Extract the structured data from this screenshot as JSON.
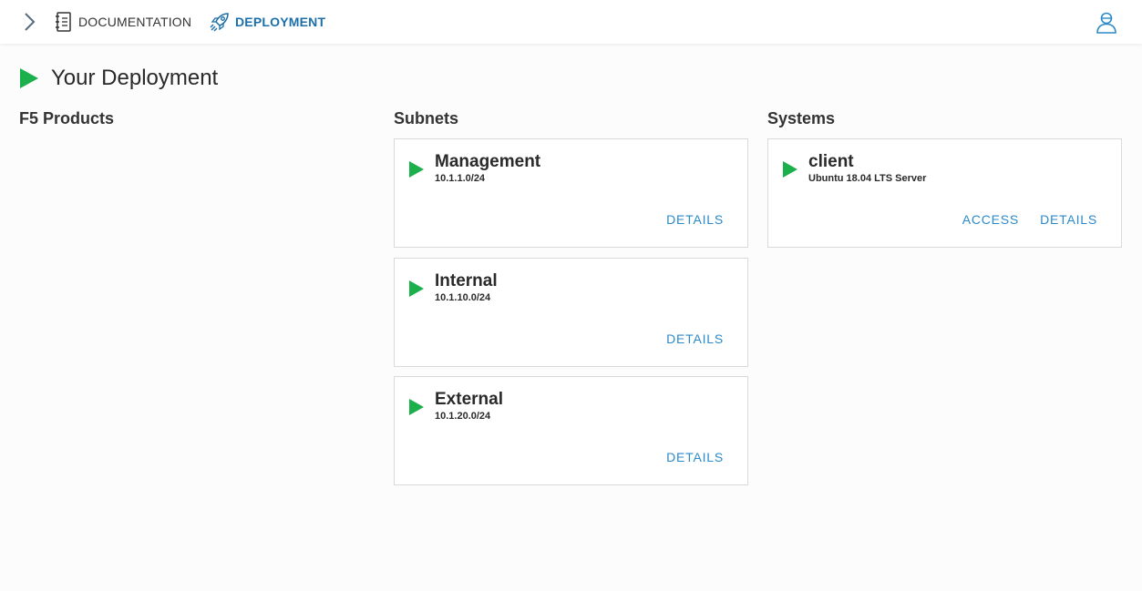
{
  "nav": {
    "docs_label": "DOCUMENTATION",
    "deploy_label": "DEPLOYMENT"
  },
  "page": {
    "title": "Your Deployment"
  },
  "columns": {
    "products": "F5 Products",
    "subnets": "Subnets",
    "systems": "Systems"
  },
  "subnets": [
    {
      "name": "Management",
      "cidr": "10.1.1.0/24",
      "details_label": "DETAILS"
    },
    {
      "name": "Internal",
      "cidr": "10.1.10.0/24",
      "details_label": "DETAILS"
    },
    {
      "name": "External",
      "cidr": "10.1.20.0/24",
      "details_label": "DETAILS"
    }
  ],
  "systems": [
    {
      "name": "client",
      "os": "Ubuntu 18.04 LTS Server",
      "access_label": "ACCESS",
      "details_label": "DETAILS"
    }
  ],
  "colors": {
    "accent": "#1b6fa8",
    "link": "#2c8ac9",
    "status_running": "#1cb04d"
  },
  "icons": {
    "menu": "chevron-right-icon",
    "docs": "notebook-icon",
    "deploy": "rocket-icon",
    "user": "user-icon",
    "status": "play-icon"
  }
}
